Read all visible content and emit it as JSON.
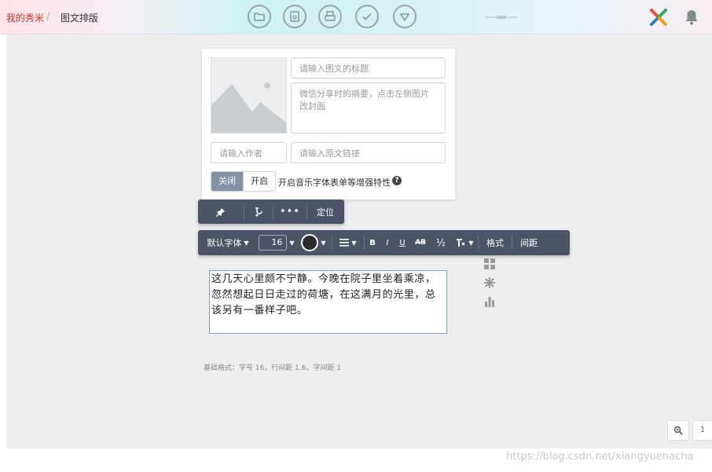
{
  "breadcrumb": {
    "root": "我的秀米",
    "separator": "/",
    "current": "图文排版"
  },
  "header": {
    "icons": [
      "folder-icon",
      "preview-icon",
      "print-icon",
      "check-icon",
      "dropdown-circle-icon"
    ],
    "brand_colors": [
      "#e74c3c",
      "#27ae60",
      "#2980b9",
      "#f39c12"
    ]
  },
  "meta_form": {
    "title_placeholder": "请输入图文的标题",
    "summary_placeholder": "微信分享时的摘要，点击左侧图片改封面",
    "author_placeholder": "请输入作者",
    "link_placeholder": "请输入原文链接",
    "toggle_off": "关闭",
    "toggle_on": "开启",
    "feature_label": "开启音乐字体表单等增强特性",
    "help_symbol": "?"
  },
  "position_toolbar": {
    "more": "•••",
    "locate": "定位"
  },
  "format_toolbar": {
    "font": "默认字体",
    "font_size": "16",
    "bold": "B",
    "italic": "I",
    "underline": "U",
    "strike": "AB",
    "fraction": "½",
    "format": "格式",
    "spacing": "间距",
    "text_color": "#2b2b2b"
  },
  "editor": {
    "text": "这几天心里颇不宁静。今晚在院子里坐着乘凉，忽然想起日日走过的荷塘，在这满月的光里，总该另有一番样子吧。"
  },
  "base_info": "基础格式：字号 16，行间距 1.6，字间距 1",
  "zoom": {
    "side_label": "1"
  },
  "watermark": "https://blog.csdn.net/xiangyuenacha"
}
